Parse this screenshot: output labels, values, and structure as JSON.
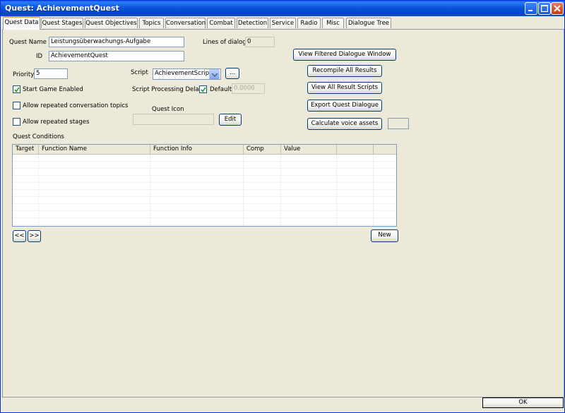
{
  "window": {
    "title": "Quest: AchievementQuest"
  },
  "tabs": [
    {
      "label": "Quest Data",
      "active": true
    },
    {
      "label": "Quest Stages"
    },
    {
      "label": "Quest Objectives"
    },
    {
      "label": "Topics"
    },
    {
      "label": "Conversation"
    },
    {
      "label": "Combat"
    },
    {
      "label": "Detection"
    },
    {
      "label": "Service"
    },
    {
      "label": "Radio"
    },
    {
      "label": "Misc"
    },
    {
      "label": "Dialogue Tree"
    }
  ],
  "quest": {
    "name_label": "Quest Name",
    "name_value": "Leistungsüberwachungs-Aufgabe",
    "id_label": "ID",
    "id_value": "AchievementQuest",
    "lines_label": "Lines of dialog:",
    "lines_value": "0",
    "priority_label": "Priority",
    "priority_value": "5",
    "script_label": "Script",
    "script_value": "AchievementScript",
    "script_browse": "...",
    "start_enabled_label": "Start Game Enabled",
    "start_enabled_checked": true,
    "processing_delay_label": "Script Processing Delay",
    "default_label": "Default",
    "default_checked": true,
    "delay_value": "0.0000",
    "repeat_topics_label": "Allow repeated conversation topics",
    "repeat_topics_checked": false,
    "repeat_stages_label": "Allow repeated stages",
    "repeat_stages_checked": false,
    "icon_label": "Quest Icon",
    "icon_edit": "Edit"
  },
  "actions": {
    "view_filtered": "View Filtered Dialogue Window",
    "recompile": "Recompile All Results",
    "view_scripts": "View All Result Scripts",
    "export_dialogue": "Export Quest Dialogue",
    "calc_voice": "Calculate voice assets"
  },
  "conditions": {
    "label": "Quest Conditions",
    "columns": [
      "Target",
      "Function Name",
      "Function Info",
      "Comp",
      "Value",
      "",
      ""
    ],
    "rows": [],
    "prev": "<<",
    "next": ">>",
    "new": "New"
  },
  "footer": {
    "ok": "OK"
  },
  "colors": {
    "titlebar": "#0a55d9",
    "face": "#ece9d8",
    "active_tab_accent": "#e6a536"
  }
}
